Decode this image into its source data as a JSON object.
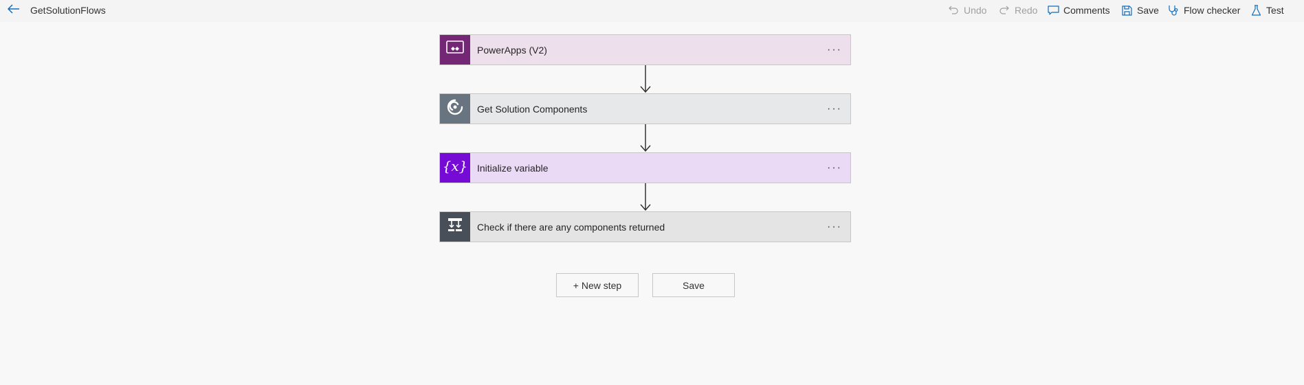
{
  "header": {
    "title": "GetSolutionFlows",
    "back_icon": "arrow-left-icon",
    "commands": {
      "undo": "Undo",
      "redo": "Redo",
      "comments": "Comments",
      "save": "Save",
      "flow_checker": "Flow checker",
      "test": "Test"
    }
  },
  "flow": {
    "steps": [
      {
        "label": "PowerApps (V2)",
        "icon": "powerapps-icon",
        "tile_color": "#742774",
        "card_color": "#ede0ec"
      },
      {
        "label": "Get Solution Components",
        "icon": "dataverse-icon",
        "tile_color": "#68747f",
        "card_color": "#e7e8e9"
      },
      {
        "label": "Initialize variable",
        "icon": "variable-icon",
        "tile_color": "#770bd6",
        "card_color": "#eadaf6"
      },
      {
        "label": "Check if there are any components returned",
        "icon": "condition-icon",
        "tile_color": "#484f58",
        "card_color": "#e4e4e5"
      }
    ],
    "more_label": "···"
  },
  "footer": {
    "new_step_label": "+ New step",
    "save_label": "Save"
  },
  "colors": {
    "accent": "#0f6cbd",
    "disabled": "#a19f9d"
  }
}
